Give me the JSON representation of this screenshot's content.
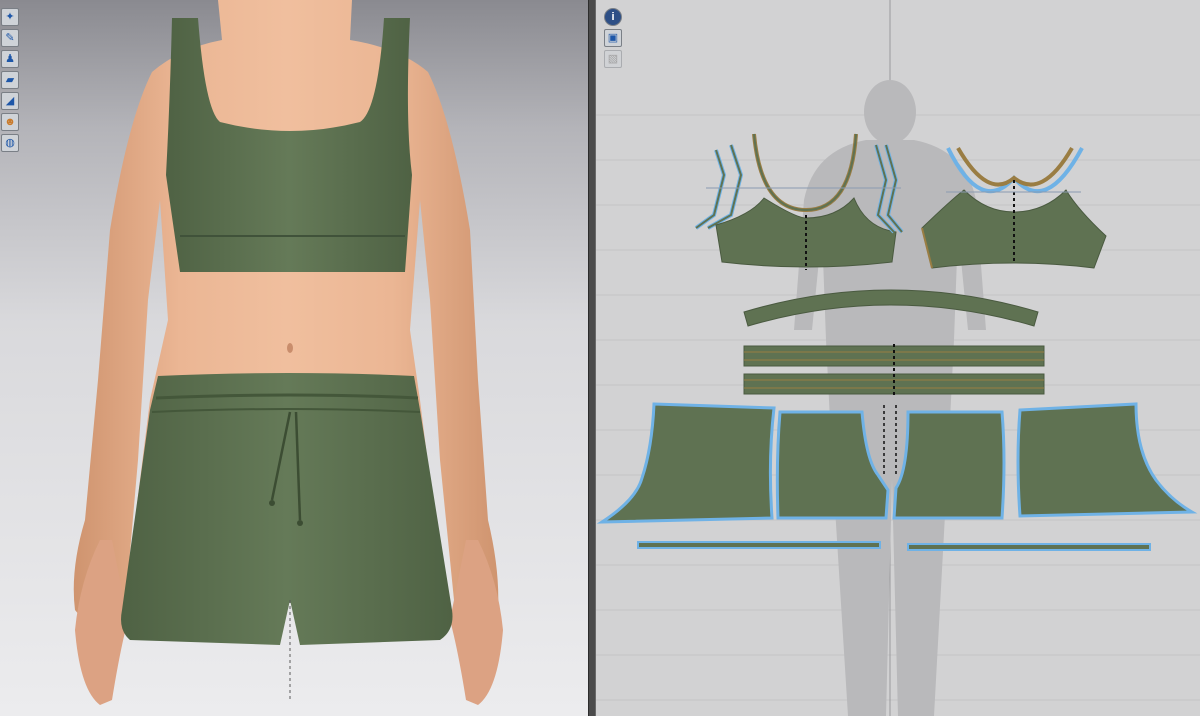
{
  "window": {
    "layout": "split-3d-2d"
  },
  "left_panel": {
    "name": "3D Garment view",
    "tools": [
      {
        "icon": "show-avatar-icon"
      },
      {
        "icon": "show-garment-icon"
      },
      {
        "icon": "avatar-pose-icon"
      },
      {
        "icon": "fabric-texture-icon"
      },
      {
        "icon": "show-pins-icon"
      },
      {
        "icon": "avatar-skin-icon"
      },
      {
        "icon": "globe-icon"
      }
    ]
  },
  "right_panel": {
    "name": "2D Pattern window",
    "tools": [
      {
        "icon": "info-icon"
      },
      {
        "icon": "pattern-layer-icon"
      },
      {
        "icon": "hidden-layer-icon",
        "disabled": true
      }
    ],
    "pattern_pieces": [
      "bra-front-left-binding",
      "bra-front",
      "bra-back",
      "bra-back-binding",
      "bra-hem-band",
      "waistband-strip-1",
      "waistband-strip-2",
      "short-front-left",
      "short-back-left",
      "short-back-right",
      "short-front-right",
      "hem-binding-left",
      "hem-binding-right"
    ]
  },
  "colors": {
    "fabric": "#5f7252",
    "fabric_dark": "#4c5e42",
    "skin": "#e6b08e",
    "seam_blue": "#6fb2e6",
    "seam_gold": "#9a7d43",
    "grid_bg": "#d2d2d3"
  }
}
